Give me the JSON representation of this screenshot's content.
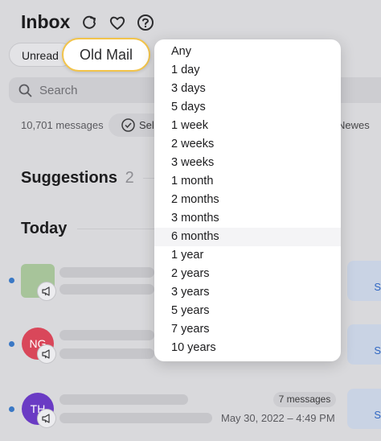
{
  "header": {
    "title": "Inbox"
  },
  "filters": {
    "unread": "Unread",
    "old_mail": "Old Mail"
  },
  "search": {
    "placeholder": "Search"
  },
  "toolbar": {
    "count": "10,701 messages",
    "select": "Sel",
    "newest": "Newes"
  },
  "sections": {
    "suggestions": "Suggestions",
    "suggestions_count": "2",
    "today": "Today"
  },
  "menu": {
    "items": [
      "Any",
      "1 day",
      "3 days",
      "5 days",
      "1 week",
      "2 weeks",
      "3 weeks",
      "1 month",
      "2 months",
      "3 months",
      "6 months",
      "1 year",
      "2 years",
      "3 years",
      "5 years",
      "7 years",
      "10 years"
    ],
    "highlighted": "6 months"
  },
  "rows": [
    {
      "avatar_text": "",
      "avatar_color": "#a7c49a",
      "action": "S"
    },
    {
      "avatar_text": "NG",
      "avatar_color": "#d9475a",
      "action": "S"
    },
    {
      "avatar_text": "TH",
      "avatar_color": "#6a3bc4",
      "badge": "7 messages",
      "date": "May 30, 2022 – 4:49 PM",
      "action": "S"
    }
  ],
  "colors": {
    "accent": "#3a78c5",
    "highlight_border": "#f2c44b"
  }
}
